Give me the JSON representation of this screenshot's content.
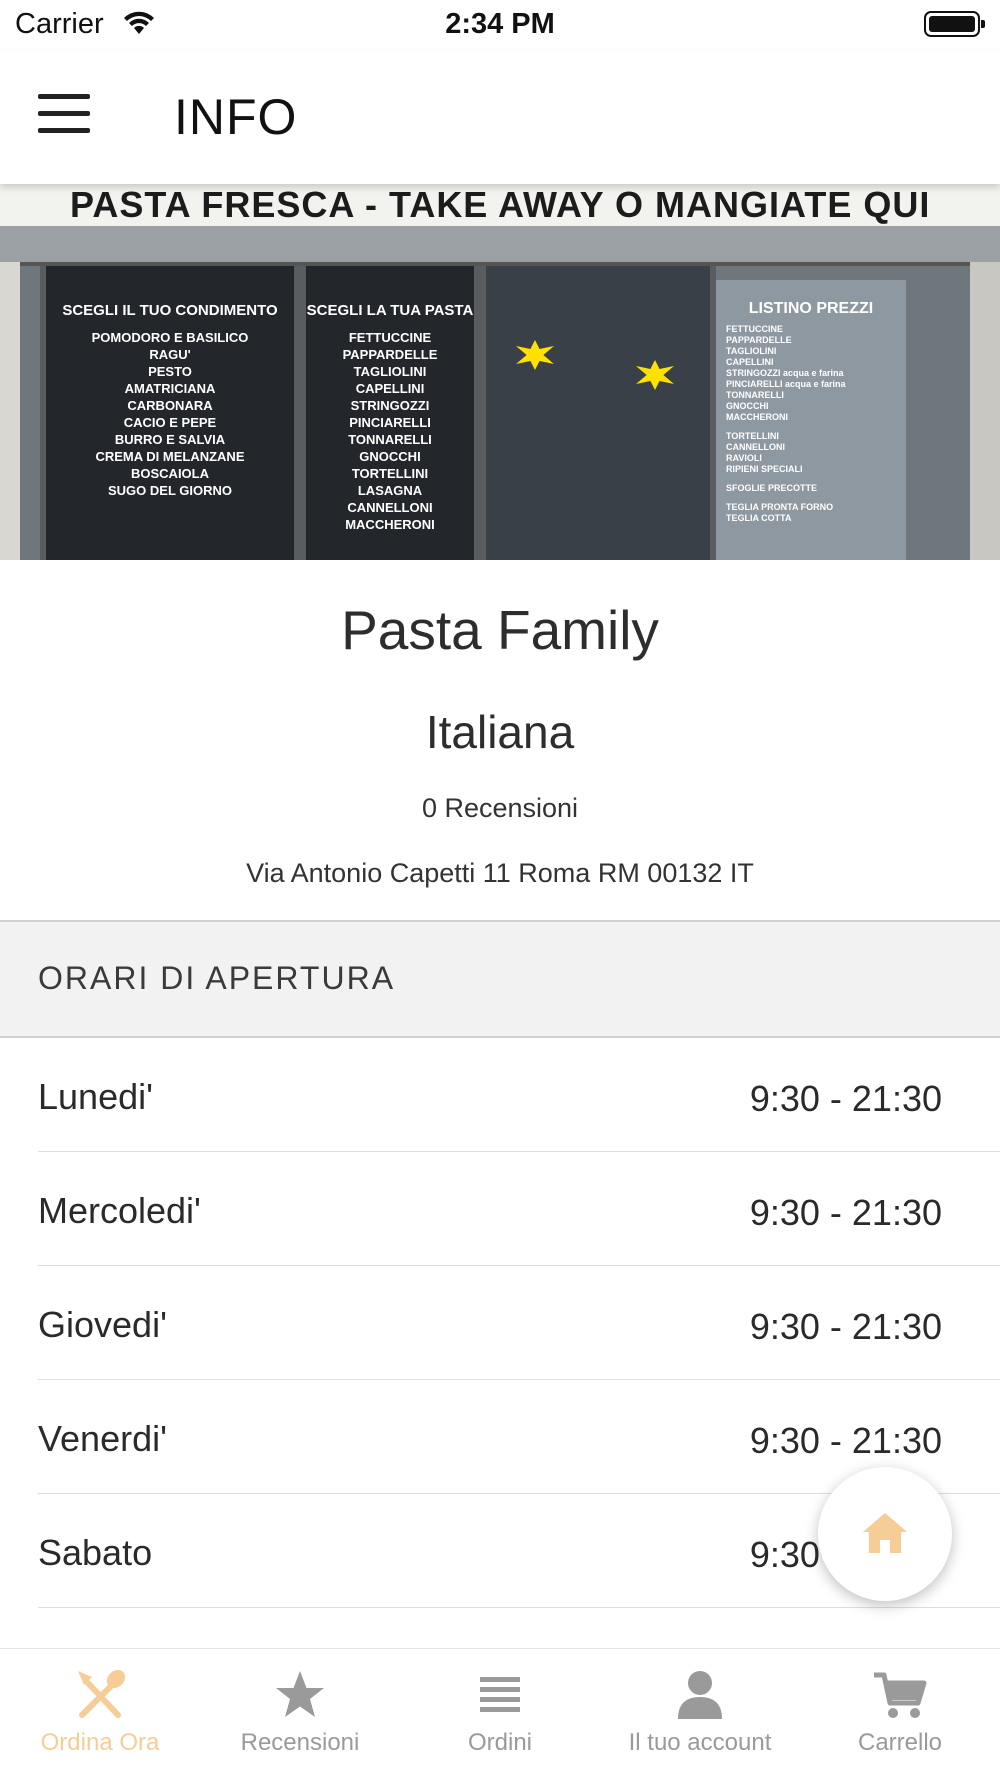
{
  "status_bar": {
    "carrier": "Carrier",
    "time": "2:34 PM"
  },
  "header": {
    "title": "INFO",
    "menu_icon": "hamburger-menu-icon"
  },
  "hero": {
    "sign_text": "PASTA FRESCA - TAKE AWAY O MANGIATE QUI",
    "panel_condimenti": {
      "title": "SCEGLI IL TUO CONDIMENTO",
      "items": [
        "POMODORO E BASILICO",
        "RAGU'",
        "PESTO",
        "AMATRICIANA",
        "CARBONARA",
        "CACIO E PEPE",
        "BURRO E SALVIA",
        "CREMA DI MELANZANE",
        "BOSCAIOLA",
        "SUGO DEL GIORNO"
      ]
    },
    "panel_pasta": {
      "title": "SCEGLI LA TUA PASTA",
      "items": [
        "FETTUCCINE",
        "PAPPARDELLE",
        "TAGLIOLINI",
        "CAPELLINI",
        "STRINGOZZI",
        "PINCIARELLI",
        "TONNARELLI",
        "GNOCCHI",
        "TORTELLINI",
        "LASAGNA",
        "CANNELLONI",
        "MACCHERONI"
      ]
    },
    "panel_prezzi": {
      "title": "LISTINO PREZZI",
      "items": [
        "FETTUCCINE",
        "PAPPARDELLE",
        "TAGLIOLINI",
        "CAPELLINI",
        "STRINGOZZI acqua e farina",
        "PINCIARELLI acqua e farina",
        "TONNARELLI",
        "GNOCCHI",
        "MACCHERONI",
        "TORTELLINI",
        "CANNELLONI",
        "RAVIOLI",
        "RIPIENI SPECIALI",
        "SFOGLIE PRECOTTE",
        "TEGLIA PRONTA FORNO",
        "TEGLIA COTTA"
      ]
    }
  },
  "restaurant": {
    "name": "Pasta Family",
    "cuisine": "Italiana",
    "reviews": "0 Recensioni",
    "address": "Via Antonio Capetti 11 Roma RM 00132 IT"
  },
  "hours": {
    "header": "ORARI DI APERTURA",
    "rows": [
      {
        "day": "Lunedi'",
        "time": "9:30 - 21:30"
      },
      {
        "day": "Mercoledi'",
        "time": "9:30 - 21:30"
      },
      {
        "day": "Giovedi'",
        "time": "9:30 - 21:30"
      },
      {
        "day": "Venerdi'",
        "time": "9:30 - 21:30"
      },
      {
        "day": "Sabato",
        "time": "9:30 - 21:30"
      }
    ]
  },
  "fab": {
    "icon": "home-icon"
  },
  "tabs": [
    {
      "label": "Ordina Ora",
      "icon": "fork-spoon-icon",
      "active": true
    },
    {
      "label": "Recensioni",
      "icon": "star-icon",
      "active": false
    },
    {
      "label": "Ordini",
      "icon": "list-icon",
      "active": false
    },
    {
      "label": "Il tuo account",
      "icon": "user-icon",
      "active": false
    },
    {
      "label": "Carrello",
      "icon": "cart-icon",
      "active": false
    }
  ],
  "colors": {
    "accent": "#f6cd96",
    "inactive": "#9a9a9a",
    "section_bg": "#f2f2f2"
  }
}
